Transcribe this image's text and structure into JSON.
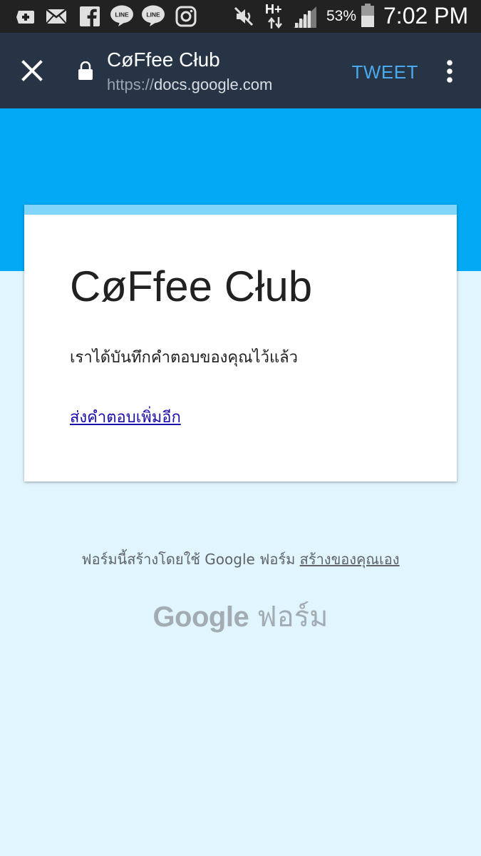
{
  "status_bar": {
    "battery_percent": "53%",
    "time": "7:02 PM",
    "network": "H+",
    "notification_icons": [
      "add-icon",
      "mail-icon",
      "facebook-icon",
      "line-icon",
      "line-icon",
      "instagram-icon"
    ],
    "status_icons": [
      "mute-icon",
      "data-transfer-icon",
      "signal-icon",
      "battery-icon"
    ]
  },
  "toolbar": {
    "title": "CøFfee Cłub",
    "url_scheme": "https://",
    "url_host": "docs.google.com",
    "action_label": "TWEET",
    "action_color": "#4aa8ec"
  },
  "card": {
    "title": "CøFfee Cłub",
    "message": "เราได้บันทึกคำตอบของคุณไว้แล้ว",
    "link": "ส่งคำตอบเพิ่มอีก"
  },
  "footer": {
    "note": "ฟอร์มนี้สร้างโดยใช้ Google ฟอร์ม",
    "note_link": "สร้างของคุณเอง",
    "logo_google": "Google",
    "logo_forms": "ฟอร์ม"
  },
  "colors": {
    "banner": "#03a9f4",
    "background": "#e1f5fe",
    "toolbar": "#263445",
    "card_accent": "#81d4fa"
  }
}
